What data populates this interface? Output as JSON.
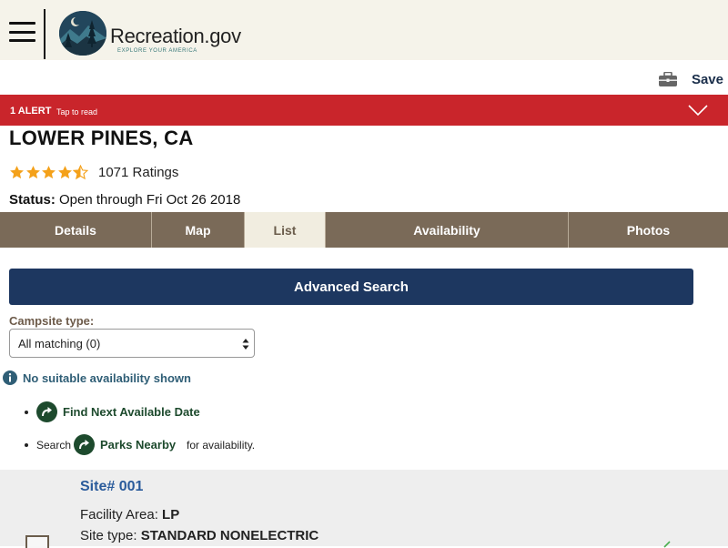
{
  "header": {
    "logo_text": "Recreation.gov",
    "logo_tagline": "EXPLORE YOUR AMERICA",
    "menu_icon": "hamburger-menu-icon"
  },
  "save": {
    "label": "Save",
    "icon": "briefcase-icon"
  },
  "alert": {
    "title": "1 ALERT",
    "subtitle": "Tap to read",
    "color": "#c9252b"
  },
  "facility": {
    "name": "LOWER PINES, CA",
    "rating_stars": 4.5,
    "ratings_text": "1071 Ratings",
    "status_label": "Status:",
    "status_value": " Open through Fri Oct 26 2018"
  },
  "tabs": [
    {
      "label": "Details",
      "active": false
    },
    {
      "label": "Map",
      "active": false
    },
    {
      "label": "List",
      "active": true
    },
    {
      "label": "Availability",
      "active": false
    },
    {
      "label": "Photos",
      "active": false
    }
  ],
  "advanced_search": {
    "label": "Advanced Search"
  },
  "campsite_type": {
    "label": "Campsite type:",
    "value": "All matching (0)"
  },
  "availability": {
    "message": "No suitable availability shown",
    "find_next": "Find Next Available Date",
    "search_prefix": "Search",
    "parks_nearby": "Parks Nearby",
    "search_suffix": "for availability."
  },
  "site": {
    "title": "Site# 001",
    "facility_area_label": "Facility Area:",
    "facility_area_value": "LP",
    "site_type_label": "Site type:",
    "site_type_value": "STANDARD NONELECTRIC"
  },
  "colors": {
    "header_bg": "#f5f3ea",
    "tab_bg": "#7a6a58",
    "tab_active_bg": "#f1ede0",
    "primary_button": "#1d3760",
    "link_green": "#1d4a2d",
    "link_blue": "#2a5b9b"
  }
}
